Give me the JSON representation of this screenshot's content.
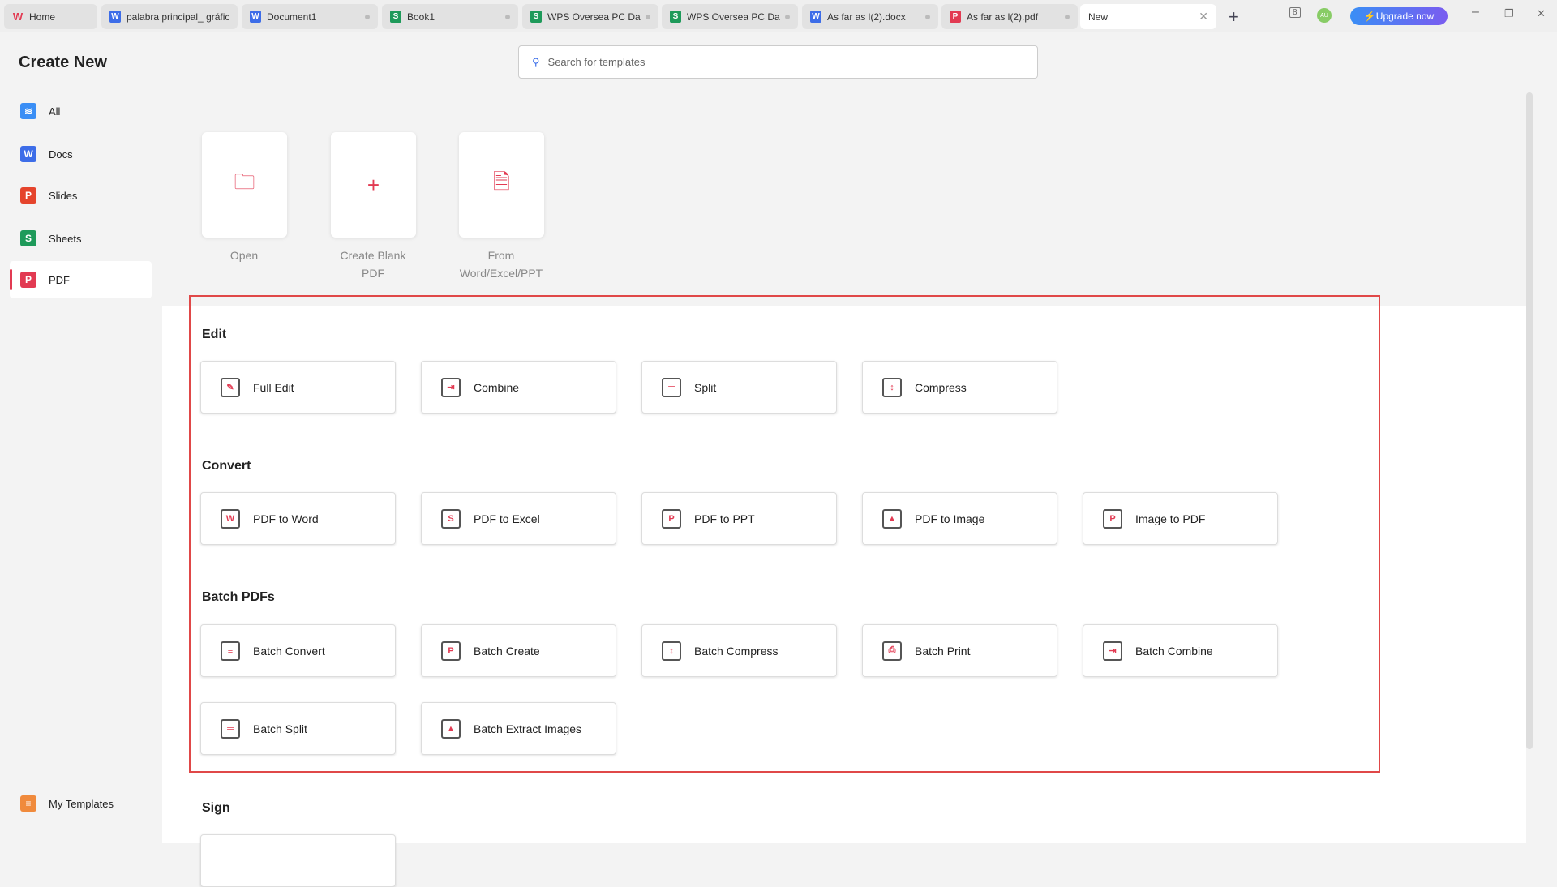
{
  "tabs": [
    {
      "label": "Home",
      "icon": "wps-logo-icon"
    },
    {
      "label": "palabra principal_ gráfica",
      "icon": "W"
    },
    {
      "label": "Document1",
      "icon": "W"
    },
    {
      "label": "Book1",
      "icon": "S"
    },
    {
      "label": "WPS Oversea PC Dash",
      "icon": "S"
    },
    {
      "label": "WPS Oversea PC Dash",
      "icon": "S"
    },
    {
      "label": "As far as l(2).docx",
      "icon": "W"
    },
    {
      "label": "As far as l(2).pdf",
      "icon": "P"
    },
    {
      "label": "New"
    }
  ],
  "header": {
    "upgrade": "Upgrade now",
    "avatar": "AU",
    "search_placeholder": "Search for templates"
  },
  "sidebar": {
    "title": "Create New",
    "items": [
      {
        "label": "All",
        "icon": "≋"
      },
      {
        "label": "Docs",
        "icon": "W"
      },
      {
        "label": "Slides",
        "icon": "P"
      },
      {
        "label": "Sheets",
        "icon": "S"
      },
      {
        "label": "PDF",
        "icon": "P"
      }
    ],
    "templates": "My Templates"
  },
  "top_cards": [
    {
      "label": "Open"
    },
    {
      "label": "Create Blank PDF"
    },
    {
      "label": "From Word/Excel/PPT"
    }
  ],
  "sections": {
    "edit": {
      "title": "Edit",
      "items": [
        "Full Edit",
        "Combine",
        "Split",
        "Compress"
      ]
    },
    "convert": {
      "title": "Convert",
      "items": [
        "PDF to Word",
        "PDF to Excel",
        "PDF to PPT",
        "PDF to Image",
        "Image to PDF"
      ]
    },
    "batch": {
      "title": "Batch PDFs",
      "items": [
        "Batch Convert",
        "Batch Create",
        "Batch Compress",
        "Batch Print",
        "Batch Combine",
        "Batch Split",
        "Batch Extract Images"
      ]
    },
    "sign": {
      "title": "Sign"
    }
  },
  "colors": {
    "accent": "#e23a52",
    "highlight": "#e04848"
  }
}
